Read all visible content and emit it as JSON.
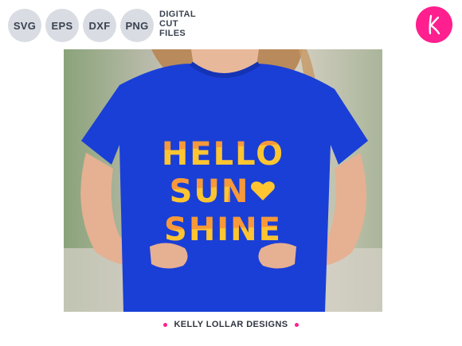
{
  "file_badges": [
    "SVG",
    "EPS",
    "DXF",
    "PNG"
  ],
  "digital_label": [
    "DIGITAL",
    "CUT",
    "FILES"
  ],
  "logo": {
    "letter": "K",
    "color": "#ff1f8e"
  },
  "design": {
    "line1": "HELLO",
    "line2": "SUN",
    "line3": "SHINE",
    "heart_icon": "heart-icon",
    "colors": {
      "shirt": "#1a3fd6",
      "letters_yellow": "#ffc531",
      "letters_orange": "#f7983a"
    }
  },
  "footer": {
    "brand": "KELLY LOLLAR DESIGNS"
  }
}
